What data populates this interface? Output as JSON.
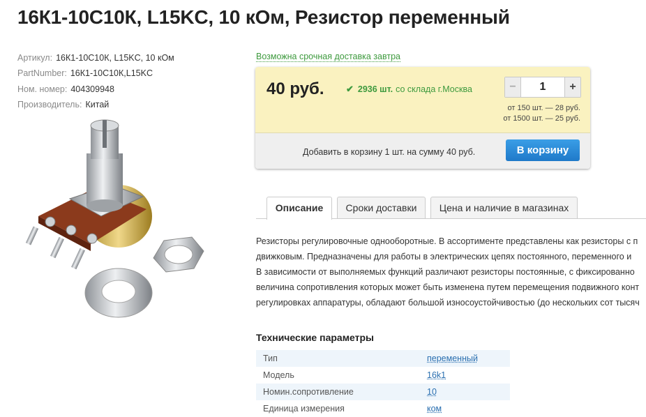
{
  "product": {
    "title": "16К1-10С10К, L15KC, 10 кОм, Резистор переменный"
  },
  "meta": [
    {
      "label": "Артикул:",
      "value": "16К1-10С10К, L15KC, 10 кОм"
    },
    {
      "label": "PartNumber:",
      "value": "16К1-10С10К,L15KC"
    },
    {
      "label": "Ном. номер:",
      "value": "404309948"
    },
    {
      "label": "Производитель:",
      "value": "Китай"
    }
  ],
  "delivery": "Возможна срочная доставка завтра",
  "buy": {
    "price": "40 руб.",
    "stock_count": "2936 шт.",
    "stock_location": "со склада г.Москва",
    "quantity": "1",
    "minus": "−",
    "plus": "+",
    "tiers": [
      "от 150 шт. — 28 руб.",
      "от 1500 шт. — 25 руб."
    ],
    "cart_summary": "Добавить в корзину 1 шт. на сумму 40 руб.",
    "cart_button": "В корзину"
  },
  "tabs": [
    "Описание",
    "Сроки доставки",
    "Цена и наличие в магазинах"
  ],
  "description": [
    "Резисторы регулировочные однооборотные. В ассортименте представлены как резисторы с п",
    "движковым. Предназначены для работы в электрических цепях постоянного, переменного и",
    "В зависимости от выполняемых функций различают резисторы постоянные, с фиксированно",
    "величина сопротивления которых может быть изменена путем перемещения подвижного конт",
    "регулировках аппаратуры, обладают большой износоустойчивостью (до нескольких сот тысяч"
  ],
  "specs": {
    "title": "Технические параметры",
    "rows": [
      {
        "name": "Тип",
        "value": "переменный"
      },
      {
        "name": "Модель",
        "value": "16k1"
      },
      {
        "name": "Номин.сопротивление",
        "value": "10"
      },
      {
        "name": "Единица измерения",
        "value": "ком"
      }
    ]
  },
  "icons": {
    "check": "check-icon",
    "image": "potentiometer-photo"
  },
  "colors": {
    "green": "#3e9a3e",
    "price_bg": "#faf2c0",
    "button_blue": "#1f79c9",
    "link": "#2a6fb0"
  }
}
